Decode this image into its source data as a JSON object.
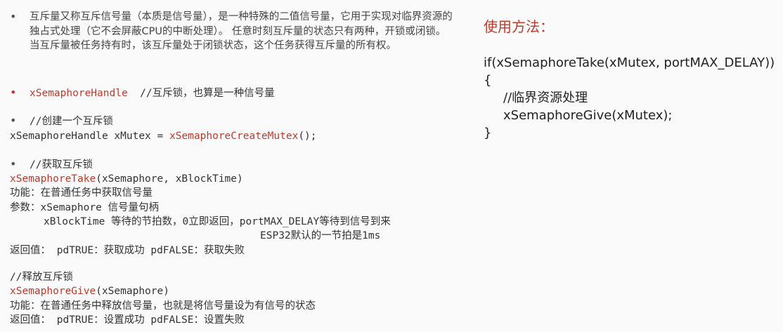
{
  "left": {
    "para1": "互斥量又称互斥信号量（本质是信号量），是一种特殊的二值信号量，它用于实现对临界资源的独占式处理（它不会屏蔽CPU的中断处理）。 任意时刻互斥量的状态只有两种，开锁或闭锁。 当互斥量被任务持有时，该互斥量处于闭锁状态，这个任务获得互斥量的所有权。",
    "handle_type": "xSemaphoreHandle",
    "handle_comment": "//互斥锁，也算是一种信号量",
    "create_comment": "//创建一个互斥锁",
    "create_prefix": "xSemaphoreHandle xMutex = ",
    "create_func": "xSemaphoreCreateMutex",
    "create_suffix": "();",
    "take_comment": "//获取互斥锁",
    "take_func": "xSemaphoreTake",
    "take_args": "(xSemaphore, xBlockTime)",
    "take_func_desc": "功能：在普通任务中获取信号量",
    "take_param1": "参数：xSemaphore 信号量句柄",
    "take_param2": "xBlockTime 等待的节拍数，0立即返回，portMAX_DELAY等待到信号到来",
    "take_param3": "ESP32默认的一节拍是1ms",
    "take_return": "返回值：  pdTRUE：获取成功  pdFALSE：获取失败",
    "give_comment": "//释放互斥锁",
    "give_func": "xSemaphoreGive",
    "give_args": "(xSemaphore)",
    "give_func_desc": "功能：在普通任务中释放信号量，也就是将信号量设为有信号的状态",
    "give_return": "返回值：  pdTRUE：设置成功  pdFALSE：设置失败"
  },
  "right": {
    "title": "使用方法：",
    "code1": "if(xSemaphoreTake(xMutex, portMAX_DELAY))",
    "code2": "{",
    "code3": "//临界资源处理",
    "code4": "xSemaphoreGive(xMutex);",
    "code5": "}"
  },
  "bullet": "•"
}
